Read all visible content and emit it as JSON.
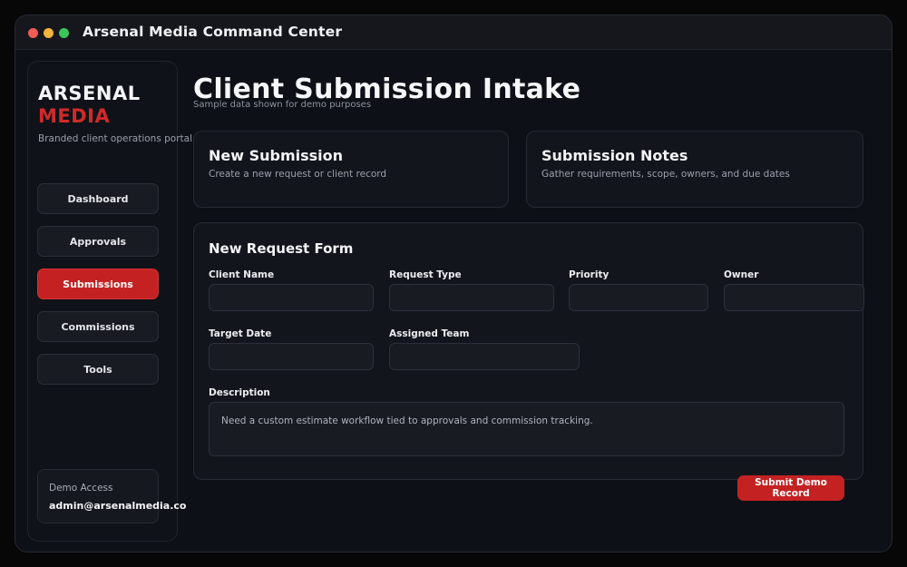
{
  "window": {
    "title": "Arsenal Media Command Center"
  },
  "brand": {
    "word1": "ARSENAL",
    "word2": "MEDIA",
    "tagline": "Branded client operations portal"
  },
  "nav": {
    "items": [
      {
        "label": "Dashboard"
      },
      {
        "label": "Approvals"
      },
      {
        "label": "Submissions"
      },
      {
        "label": "Commissions"
      },
      {
        "label": "Tools"
      }
    ],
    "active": "Submissions"
  },
  "demo": {
    "label": "Demo Access",
    "email": "admin@arsenalmedia.co"
  },
  "page": {
    "title": "Client Submission Intake",
    "subtitle": "Sample data shown for demo purposes"
  },
  "cards": {
    "new_submission": {
      "title": "New Submission",
      "desc": "Create a new request or client record"
    },
    "notes": {
      "title": "Submission Notes",
      "desc": "Gather requirements, scope, owners, and due dates"
    }
  },
  "form": {
    "title": "New Request Form",
    "labels": {
      "client_name": "Client Name",
      "request_type": "Request Type",
      "priority": "Priority",
      "owner": "Owner",
      "target_date": "Target Date",
      "assigned_team": "Assigned Team",
      "description": "Description"
    },
    "values": {
      "client_name": "",
      "request_type": "",
      "priority": "",
      "owner": "",
      "target_date": "",
      "assigned_team": "",
      "description": "Need a custom estimate workflow tied to approvals and commission tracking."
    },
    "submit_label": "Submit Demo Record"
  },
  "colors": {
    "accent": "#c42222",
    "brand_red": "#d12a2a",
    "background": "#0d1016"
  }
}
